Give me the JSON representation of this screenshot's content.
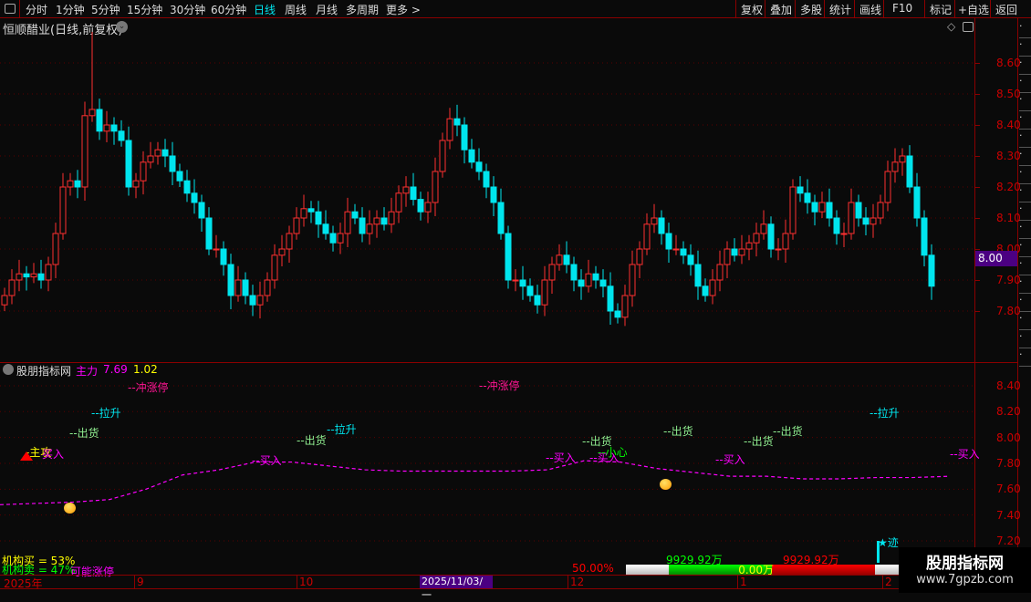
{
  "toolbar": {
    "periods": [
      "分时",
      "1分钟",
      "5分钟",
      "15分钟",
      "30分钟",
      "60分钟",
      "日线",
      "周线",
      "月线",
      "多周期",
      "更多 >"
    ],
    "active_period": "日线",
    "buttons": [
      "复权",
      "叠加",
      "多股",
      "统计",
      "画线",
      "F10",
      "标记",
      "+自选",
      "返回"
    ]
  },
  "main_chart": {
    "title": "恒顺醋业(日线,前复权)",
    "price_ticks": [
      "8.60",
      "8.50",
      "8.40",
      "8.30",
      "8.20",
      "8.10",
      "8.00",
      "7.90",
      "7.80"
    ],
    "current_price": "8.00"
  },
  "chart_data": {
    "type": "candlestick",
    "ylim": [
      7.72,
      8.78
    ],
    "closes": [
      7.85,
      7.9,
      7.92,
      7.91,
      7.92,
      7.9,
      7.95,
      8.05,
      8.2,
      8.22,
      8.2,
      8.43,
      8.45,
      8.38,
      8.4,
      8.38,
      8.35,
      8.2,
      8.22,
      8.28,
      8.3,
      8.32,
      8.3,
      8.25,
      8.22,
      8.18,
      8.15,
      8.1,
      8.0,
      8.0,
      7.95,
      7.85,
      7.9,
      7.85,
      7.82,
      7.85,
      7.9,
      7.98,
      8.0,
      8.05,
      8.1,
      8.13,
      8.12,
      8.08,
      8.05,
      8.02,
      8.05,
      8.12,
      8.1,
      8.05,
      8.08,
      8.1,
      8.08,
      8.12,
      8.18,
      8.2,
      8.16,
      8.12,
      8.15,
      8.25,
      8.35,
      8.42,
      8.4,
      8.32,
      8.28,
      8.25,
      8.2,
      8.15,
      8.05,
      7.9,
      7.9,
      7.88,
      7.85,
      7.82,
      7.9,
      7.95,
      7.98,
      7.95,
      7.9,
      7.88,
      7.92,
      7.9,
      7.88,
      7.8,
      7.78,
      7.85,
      7.95,
      8.0,
      8.08,
      8.1,
      8.05,
      8.0,
      8.0,
      7.98,
      7.95,
      7.88,
      7.85,
      7.9,
      7.95,
      8.0,
      7.98,
      8.0,
      8.02,
      8.05,
      8.08,
      8.0,
      8.0,
      8.05,
      8.2,
      8.18,
      8.15,
      8.12,
      8.15,
      8.1,
      8.05,
      8.05,
      8.15,
      8.1,
      8.08,
      8.1,
      8.15,
      8.25,
      8.28,
      8.3,
      8.2,
      8.1,
      7.98,
      7.88
    ],
    "indicator": {
      "name": "主力",
      "value": "7.69",
      "ratio": "1.02",
      "ylim": [
        7.15,
        8.48
      ],
      "ticks": [
        "8.40",
        "8.20",
        "8.00",
        "7.80",
        "7.60",
        "7.40",
        "7.20"
      ],
      "line": [
        7.48,
        7.49,
        7.5,
        7.52,
        7.6,
        7.71,
        7.75,
        7.81,
        7.81,
        7.78,
        7.75,
        7.74,
        7.74,
        7.74,
        7.74,
        7.75,
        7.82,
        7.81,
        7.76,
        7.73,
        7.7,
        7.7,
        7.68,
        7.68,
        7.69,
        7.69,
        7.7
      ],
      "signals": [
        "--冲涨停",
        "--冲涨停",
        "--拉升",
        "--拉升",
        "--拉升",
        "--出货",
        "--出货",
        "--出货",
        "--出货",
        "--出货",
        "--出货",
        "-主攻",
        "买入",
        "--买入",
        "--买入",
        "--买入",
        "--买入",
        "--买入",
        "--小心",
        "★迹"
      ]
    }
  },
  "stats": {
    "buy": "机构买 = 53%",
    "sell": "机构卖 = 47%",
    "hint": "可能涨停",
    "pct": "50.00%",
    "vol_left": "9929.92万",
    "vol_mid": "0.00万",
    "vol_right": "9929.92万"
  },
  "time_axis": [
    "2025年",
    "9",
    "10",
    "2025/11/03/一",
    "12",
    "1",
    "2"
  ],
  "watermark": {
    "name": "股朋指标网",
    "url": "www.7gpzb.com"
  },
  "indicator_title": "股朋指标网",
  "colors": {
    "up": "#ff3030",
    "down": "#00e5ee",
    "grid": "#8b0000",
    "accent": "#4b0082"
  }
}
